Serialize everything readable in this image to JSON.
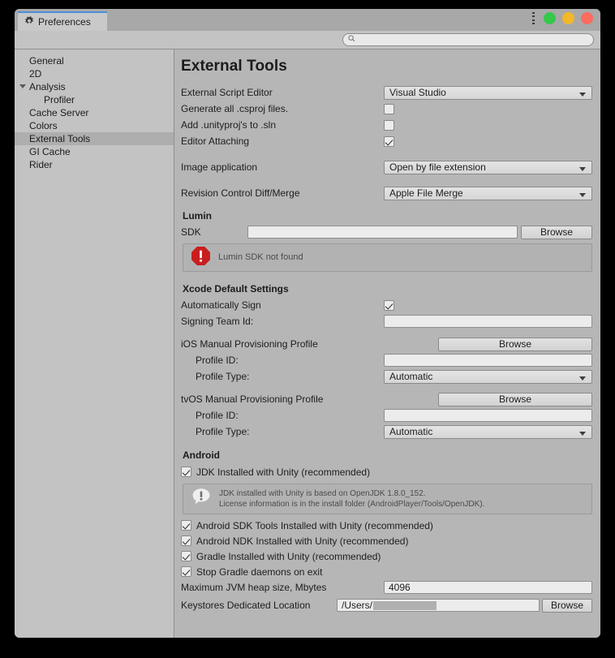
{
  "window": {
    "tab_label": "Preferences",
    "tab_icon": "gear-icon",
    "controls": {
      "minimize_color": "#35c84a",
      "maximize_color": "#f4b728",
      "close_color": "#fb6b5f"
    }
  },
  "search": {
    "value": "",
    "placeholder": "",
    "icon": "search-icon"
  },
  "sidebar": {
    "items": [
      {
        "label": "General",
        "selected": false,
        "indent": false,
        "expander": false
      },
      {
        "label": "2D",
        "selected": false,
        "indent": false,
        "expander": false
      },
      {
        "label": "Analysis",
        "selected": false,
        "indent": false,
        "expander": true
      },
      {
        "label": "Profiler",
        "selected": false,
        "indent": true,
        "expander": false
      },
      {
        "label": "Cache Server",
        "selected": false,
        "indent": false,
        "expander": false
      },
      {
        "label": "Colors",
        "selected": false,
        "indent": false,
        "expander": false
      },
      {
        "label": "External Tools",
        "selected": true,
        "indent": false,
        "expander": false
      },
      {
        "label": "GI Cache",
        "selected": false,
        "indent": false,
        "expander": false
      },
      {
        "label": "Rider",
        "selected": false,
        "indent": false,
        "expander": false
      }
    ]
  },
  "main": {
    "page_title": "External Tools",
    "external_script_editor": {
      "label": "External Script Editor",
      "value": "Visual Studio"
    },
    "generate_csproj": {
      "label": "Generate all .csproj files.",
      "checked": false
    },
    "add_unityproj": {
      "label": "Add .unityproj's to .sln",
      "checked": false
    },
    "editor_attaching": {
      "label": "Editor Attaching",
      "checked": true
    },
    "image_application": {
      "label": "Image application",
      "value": "Open by file extension"
    },
    "revision_control": {
      "label": "Revision Control Diff/Merge",
      "value": "Apple File Merge"
    },
    "lumin": {
      "section_title": "Lumin",
      "sdk_label": "SDK",
      "sdk_value": "",
      "browse_label": "Browse",
      "error_message": "Lumin SDK not found",
      "error_icon": "error-octagon-icon",
      "error_color": "#c81e1e"
    },
    "xcode": {
      "section_title": "Xcode Default Settings",
      "automatically_sign": {
        "label": "Automatically Sign",
        "checked": true
      },
      "signing_team_id": {
        "label": "Signing Team Id:",
        "value": ""
      },
      "ios_profile": {
        "label": "iOS Manual Provisioning Profile",
        "browse_label": "Browse",
        "profile_id_label": "Profile ID:",
        "profile_id_value": "",
        "profile_type_label": "Profile Type:",
        "profile_type_value": "Automatic"
      },
      "tvos_profile": {
        "label": "tvOS Manual Provisioning Profile",
        "browse_label": "Browse",
        "profile_id_label": "Profile ID:",
        "profile_id_value": "",
        "profile_type_label": "Profile Type:",
        "profile_type_value": "Automatic"
      }
    },
    "android": {
      "section_title": "Android",
      "jdk_installed": {
        "label": "JDK Installed with Unity (recommended)",
        "checked": true
      },
      "info_icon": "info-bubble-icon",
      "info_line1": "JDK installed with Unity is based on OpenJDK 1.8.0_152.",
      "info_line2": "License information is in the install folder (AndroidPlayer/Tools/OpenJDK).",
      "sdk_tools": {
        "label": "Android SDK Tools Installed with Unity (recommended)",
        "checked": true
      },
      "ndk": {
        "label": "Android NDK Installed with Unity (recommended)",
        "checked": true
      },
      "gradle": {
        "label": "Gradle Installed with Unity (recommended)",
        "checked": true
      },
      "stop_gradle": {
        "label": "Stop Gradle daemons on exit",
        "checked": true
      },
      "jvm_heap": {
        "label": "Maximum JVM heap size, Mbytes",
        "value": "4096"
      },
      "keystores": {
        "label": "Keystores Dedicated Location",
        "value": "/Users/",
        "browse_label": "Browse"
      }
    }
  }
}
